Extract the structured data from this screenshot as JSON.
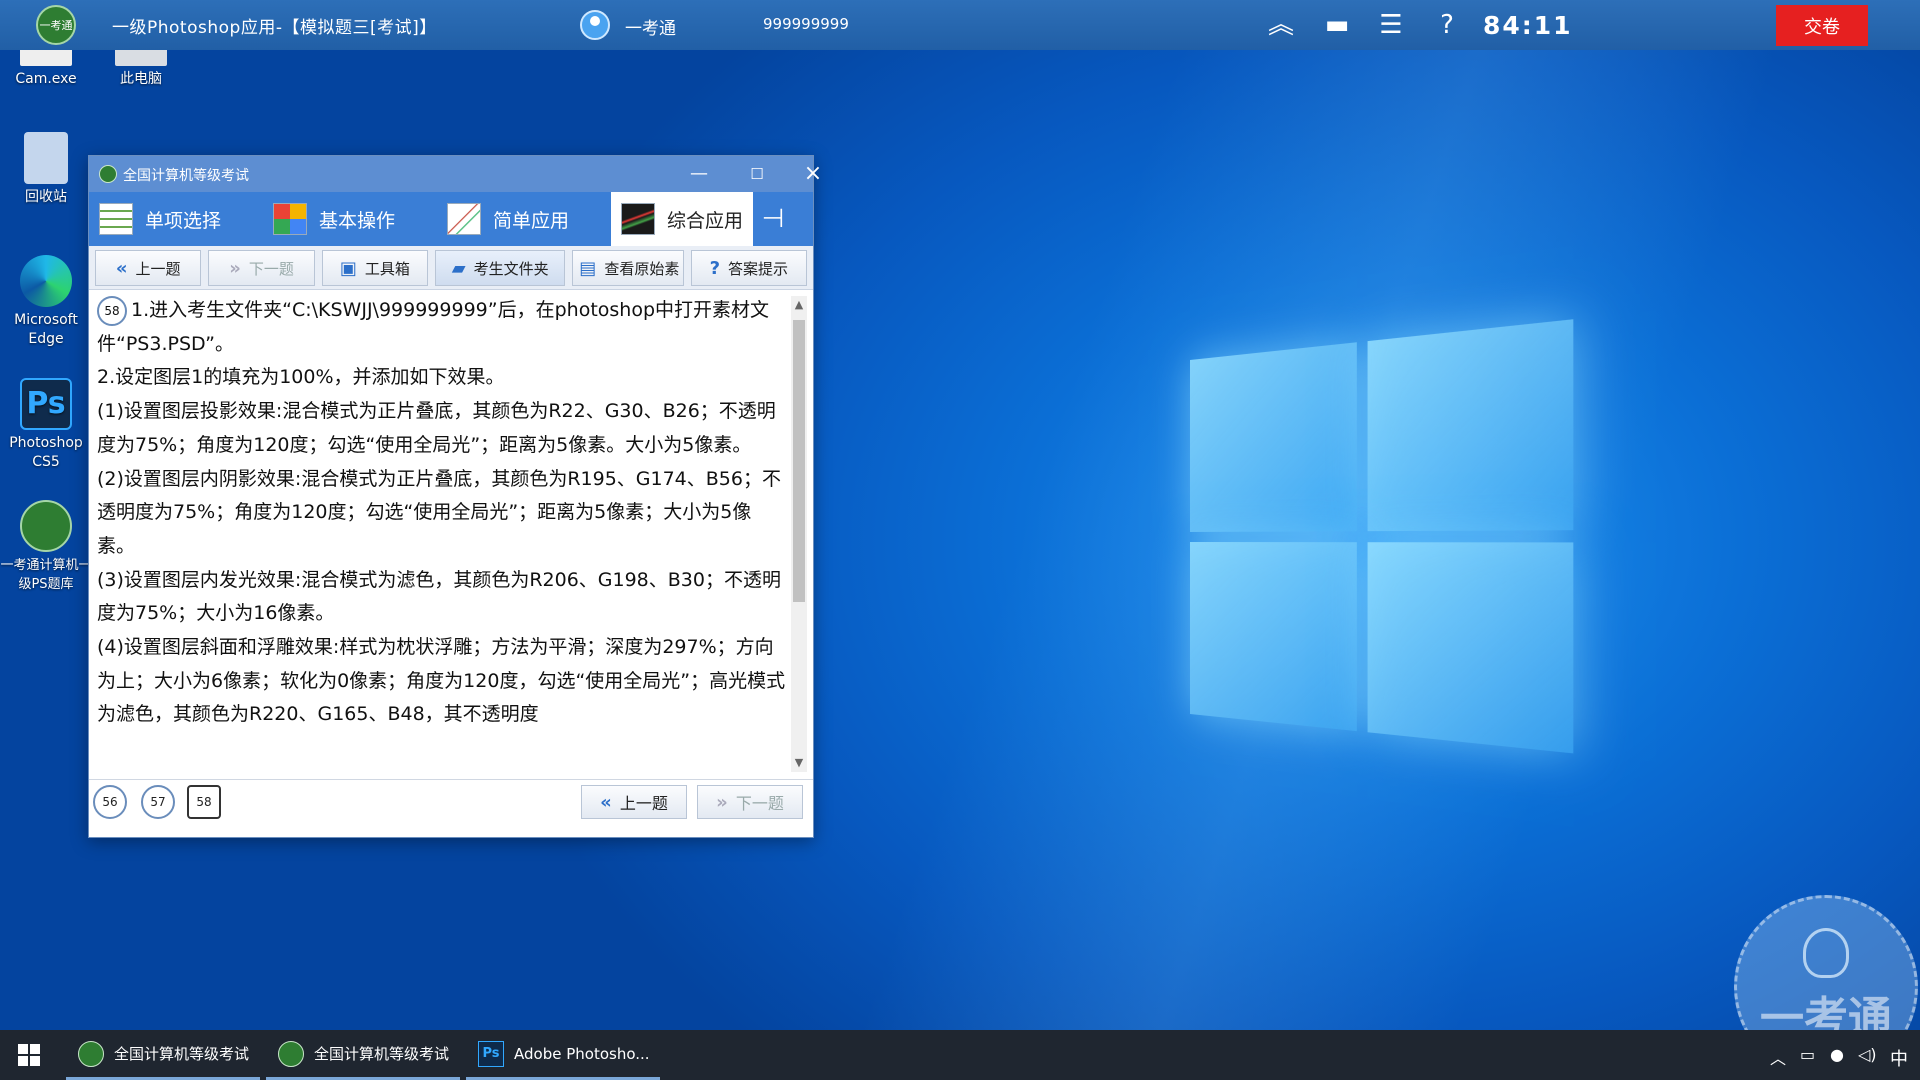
{
  "topbar": {
    "logo_text": "一考通",
    "title": "一级Photoshop应用-【模拟题三[考试]】",
    "user_name": "一考通",
    "user_id": "999999999",
    "timer": "84:11",
    "submit_label": "交卷",
    "icons": [
      "collapse-up-icon",
      "monitor-icon",
      "checklist-icon",
      "help-icon"
    ]
  },
  "desktop": {
    "icons": [
      {
        "label": "Cam.exe"
      },
      {
        "label": "此电脑"
      },
      {
        "label": "回收站"
      },
      {
        "label": "Microsoft Edge"
      },
      {
        "label": "Photoshop CS5"
      },
      {
        "label": "一考通计算机一级PS题库"
      }
    ],
    "ps_glyph": "Ps"
  },
  "window": {
    "title": "全国计算机等级考试",
    "tabs": [
      {
        "label": "单项选择"
      },
      {
        "label": "基本操作"
      },
      {
        "label": "简单应用"
      },
      {
        "label": "综合应用",
        "active": true
      }
    ],
    "toolbar": {
      "prev": "上一题",
      "next": "下一题",
      "toolbox": "工具箱",
      "student_folder": "考生文件夹",
      "view_source": "查看原始素",
      "answer_hint": "答案提示"
    },
    "question": {
      "number": "58",
      "lines": [
        "1.进入考生文件夹“C:\\KSWJJ\\999999999”后，在photoshop中打开素材文件“PS3.PSD”。",
        "2.设定图层1的填充为100%，并添加如下效果。",
        "(1)设置图层投影效果:混合模式为正片叠底，其颜色为R22、G30、B26；不透明度为75%；角度为120度；勾选“使用全局光”；距离为5像素。大小为5像素。",
        "(2)设置图层内阴影效果:混合模式为正片叠底，其颜色为R195、G174、B56；不透明度为75%；角度为120度；勾选“使用全局光”；距离为5像素；大小为5像素。",
        "(3)设置图层内发光效果:混合模式为滤色，其颜色为R206、G198、B30；不透明度为75%；大小为16像素。",
        "(4)设置图层斜面和浮雕效果:样式为枕状浮雕；方法为平滑；深度为297%；方向为上；大小为6像素；软化为0像素；角度为120度，勾选“使用全局光”；高光模式为滤色，其颜色为R220、G165、B48，其不透明度"
      ]
    },
    "question_nav": [
      "56",
      "57",
      "58"
    ],
    "current_question": "58",
    "bottom_prev": "上一题",
    "bottom_next": "下一题"
  },
  "watermark": {
    "text": "一考通"
  },
  "taskbar": {
    "items": [
      {
        "label": "全国计算机等级考试"
      },
      {
        "label": "全国计算机等级考试"
      },
      {
        "label": "Adobe Photosho..."
      }
    ],
    "ps_glyph": "Ps",
    "ime": "中"
  },
  "colors": {
    "topbar": "#215fa6",
    "submit": "#e62020",
    "tabbar": "#3a7ed6",
    "window_title": "#5d8ed2"
  }
}
